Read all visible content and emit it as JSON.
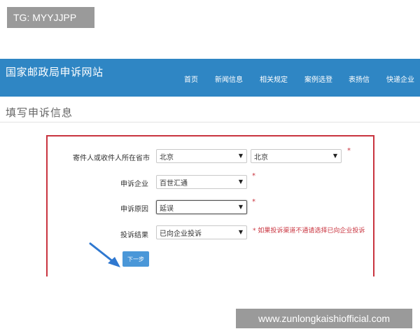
{
  "watermarks": {
    "tg": "TG: MYYJJPP",
    "url": "www.zunlongkaishiofficial.com"
  },
  "header": {
    "site_title": "国家邮政局申诉网站",
    "nav": [
      "首页",
      "新闻信息",
      "相关规定",
      "案例选登",
      "表扬信",
      "快递企业"
    ]
  },
  "page": {
    "heading": "填写申诉信息"
  },
  "form": {
    "location": {
      "label": "寄件人或收件人所在省市",
      "province": "北京",
      "city": "北京"
    },
    "company": {
      "label": "申诉企业",
      "value": "百世汇通"
    },
    "reason": {
      "label": "申诉原因",
      "value": "延误"
    },
    "result": {
      "label": "投诉结果",
      "value": "已向企业投诉",
      "hint": "* 如果投诉渠道不通请选择已向企业投诉"
    },
    "required_mark": "*",
    "next_button": "下一步"
  },
  "colors": {
    "header_bg": "#2f86c4",
    "form_border": "#c9343f",
    "button_bg": "#4a97d8",
    "pointer_arrow": "#2f78d0"
  }
}
